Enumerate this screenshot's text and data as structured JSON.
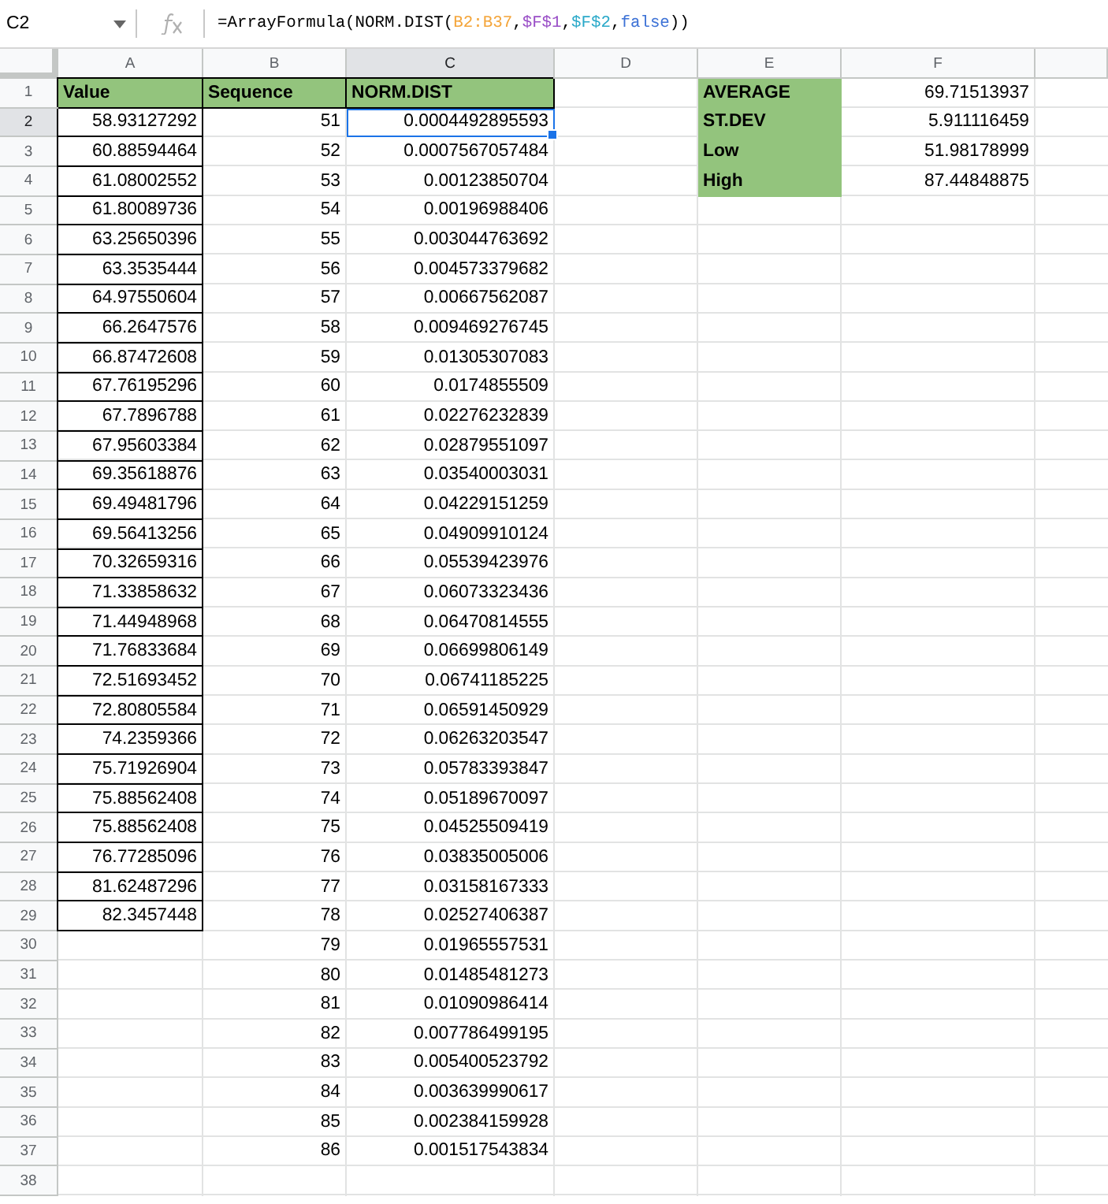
{
  "formula_bar": {
    "cell_ref": "C2",
    "formula": [
      {
        "text": "=ArrayFormula(NORM.DIST(",
        "color": "#000000"
      },
      {
        "text": "B2:B37",
        "color": "#f4a53a"
      },
      {
        "text": ",",
        "color": "#000000"
      },
      {
        "text": "$F$1",
        "color": "#9a4fc7"
      },
      {
        "text": ",",
        "color": "#000000"
      },
      {
        "text": "$F$2",
        "color": "#2ba9c9"
      },
      {
        "text": ",",
        "color": "#000000"
      },
      {
        "text": "false",
        "color": "#3d72d6"
      },
      {
        "text": "))",
        "color": "#000000"
      }
    ]
  },
  "row_numbers": [
    "1",
    "2",
    "3",
    "4",
    "5",
    "6",
    "7",
    "8",
    "9",
    "10",
    "11",
    "12",
    "13",
    "14",
    "15",
    "16",
    "17",
    "18",
    "19",
    "20",
    "21",
    "22",
    "23",
    "24",
    "25",
    "26",
    "27",
    "28",
    "29",
    "30",
    "31",
    "32",
    "33",
    "34",
    "35",
    "36",
    "37",
    "38"
  ],
  "columns": [
    {
      "letter": "A",
      "cells": [
        {
          "text": "Value",
          "kind": "header",
          "selected": false
        },
        {
          "text": "58.93127292",
          "kind": "boxed",
          "selected": false
        },
        {
          "text": "60.88594464",
          "kind": "boxed",
          "selected": false
        },
        {
          "text": "61.08002552",
          "kind": "boxed",
          "selected": false
        },
        {
          "text": "61.80089736",
          "kind": "boxed",
          "selected": false
        },
        {
          "text": "63.25650396",
          "kind": "boxed",
          "selected": false
        },
        {
          "text": "63.3535444",
          "kind": "boxed",
          "selected": false
        },
        {
          "text": "64.97550604",
          "kind": "boxed",
          "selected": false
        },
        {
          "text": "66.2647576",
          "kind": "boxed",
          "selected": false
        },
        {
          "text": "66.87472608",
          "kind": "boxed",
          "selected": false
        },
        {
          "text": "67.76195296",
          "kind": "boxed",
          "selected": false
        },
        {
          "text": "67.7896788",
          "kind": "boxed",
          "selected": false
        },
        {
          "text": "67.95603384",
          "kind": "boxed",
          "selected": false
        },
        {
          "text": "69.35618876",
          "kind": "boxed",
          "selected": false
        },
        {
          "text": "69.49481796",
          "kind": "boxed",
          "selected": false
        },
        {
          "text": "69.56413256",
          "kind": "boxed",
          "selected": false
        },
        {
          "text": "70.32659316",
          "kind": "boxed",
          "selected": false
        },
        {
          "text": "71.33858632",
          "kind": "boxed",
          "selected": false
        },
        {
          "text": "71.44948968",
          "kind": "boxed",
          "selected": false
        },
        {
          "text": "71.76833684",
          "kind": "boxed",
          "selected": false
        },
        {
          "text": "72.51693452",
          "kind": "boxed",
          "selected": false
        },
        {
          "text": "72.80805584",
          "kind": "boxed",
          "selected": false
        },
        {
          "text": "74.2359366",
          "kind": "boxed",
          "selected": false
        },
        {
          "text": "75.71926904",
          "kind": "boxed",
          "selected": false
        },
        {
          "text": "75.88562408",
          "kind": "boxed",
          "selected": false
        },
        {
          "text": "75.88562408",
          "kind": "boxed",
          "selected": false
        },
        {
          "text": "76.77285096",
          "kind": "boxed",
          "selected": false
        },
        {
          "text": "81.62487296",
          "kind": "boxed",
          "selected": false
        },
        {
          "text": "82.3457448",
          "kind": "boxed",
          "selected": false
        }
      ]
    },
    {
      "letter": "B",
      "cells": [
        {
          "text": "Sequence",
          "kind": "header",
          "selected": false
        },
        {
          "text": "51",
          "kind": "number",
          "selected": false
        },
        {
          "text": "52",
          "kind": "number",
          "selected": false
        },
        {
          "text": "53",
          "kind": "number",
          "selected": false
        },
        {
          "text": "54",
          "kind": "number",
          "selected": false
        },
        {
          "text": "55",
          "kind": "number",
          "selected": false
        },
        {
          "text": "56",
          "kind": "number",
          "selected": false
        },
        {
          "text": "57",
          "kind": "number",
          "selected": false
        },
        {
          "text": "58",
          "kind": "number",
          "selected": false
        },
        {
          "text": "59",
          "kind": "number",
          "selected": false
        },
        {
          "text": "60",
          "kind": "number",
          "selected": false
        },
        {
          "text": "61",
          "kind": "number",
          "selected": false
        },
        {
          "text": "62",
          "kind": "number",
          "selected": false
        },
        {
          "text": "63",
          "kind": "number",
          "selected": false
        },
        {
          "text": "64",
          "kind": "number",
          "selected": false
        },
        {
          "text": "65",
          "kind": "number",
          "selected": false
        },
        {
          "text": "66",
          "kind": "number",
          "selected": false
        },
        {
          "text": "67",
          "kind": "number",
          "selected": false
        },
        {
          "text": "68",
          "kind": "number",
          "selected": false
        },
        {
          "text": "69",
          "kind": "number",
          "selected": false
        },
        {
          "text": "70",
          "kind": "number",
          "selected": false
        },
        {
          "text": "71",
          "kind": "number",
          "selected": false
        },
        {
          "text": "72",
          "kind": "number",
          "selected": false
        },
        {
          "text": "73",
          "kind": "number",
          "selected": false
        },
        {
          "text": "74",
          "kind": "number",
          "selected": false
        },
        {
          "text": "75",
          "kind": "number",
          "selected": false
        },
        {
          "text": "76",
          "kind": "number",
          "selected": false
        },
        {
          "text": "77",
          "kind": "number",
          "selected": false
        },
        {
          "text": "78",
          "kind": "number",
          "selected": false
        },
        {
          "text": "79",
          "kind": "number",
          "selected": false
        },
        {
          "text": "80",
          "kind": "number",
          "selected": false
        },
        {
          "text": "81",
          "kind": "number",
          "selected": false
        },
        {
          "text": "82",
          "kind": "number",
          "selected": false
        },
        {
          "text": "83",
          "kind": "number",
          "selected": false
        },
        {
          "text": "84",
          "kind": "number",
          "selected": false
        },
        {
          "text": "85",
          "kind": "number",
          "selected": false
        },
        {
          "text": "86",
          "kind": "number",
          "selected": false
        }
      ]
    },
    {
      "letter": "C",
      "cells": [
        {
          "text": "NORM.DIST",
          "kind": "header",
          "selected": false
        },
        {
          "text": "0.0004492895593",
          "kind": "number",
          "selected": true
        },
        {
          "text": "0.0007567057484",
          "kind": "number",
          "selected": false
        },
        {
          "text": "0.00123850704",
          "kind": "number",
          "selected": false
        },
        {
          "text": "0.00196988406",
          "kind": "number",
          "selected": false
        },
        {
          "text": "0.003044763692",
          "kind": "number",
          "selected": false
        },
        {
          "text": "0.004573379682",
          "kind": "number",
          "selected": false
        },
        {
          "text": "0.00667562087",
          "kind": "number",
          "selected": false
        },
        {
          "text": "0.009469276745",
          "kind": "number",
          "selected": false
        },
        {
          "text": "0.01305307083",
          "kind": "number",
          "selected": false
        },
        {
          "text": "0.0174855509",
          "kind": "number",
          "selected": false
        },
        {
          "text": "0.02276232839",
          "kind": "number",
          "selected": false
        },
        {
          "text": "0.02879551097",
          "kind": "number",
          "selected": false
        },
        {
          "text": "0.03540003031",
          "kind": "number",
          "selected": false
        },
        {
          "text": "0.04229151259",
          "kind": "number",
          "selected": false
        },
        {
          "text": "0.04909910124",
          "kind": "number",
          "selected": false
        },
        {
          "text": "0.05539423976",
          "kind": "number",
          "selected": false
        },
        {
          "text": "0.06073323436",
          "kind": "number",
          "selected": false
        },
        {
          "text": "0.06470814555",
          "kind": "number",
          "selected": false
        },
        {
          "text": "0.06699806149",
          "kind": "number",
          "selected": false
        },
        {
          "text": "0.06741185225",
          "kind": "number",
          "selected": false
        },
        {
          "text": "0.06591450929",
          "kind": "number",
          "selected": false
        },
        {
          "text": "0.06263203547",
          "kind": "number",
          "selected": false
        },
        {
          "text": "0.05783393847",
          "kind": "number",
          "selected": false
        },
        {
          "text": "0.05189670097",
          "kind": "number",
          "selected": false
        },
        {
          "text": "0.04525509419",
          "kind": "number",
          "selected": false
        },
        {
          "text": "0.03835005006",
          "kind": "number",
          "selected": false
        },
        {
          "text": "0.03158167333",
          "kind": "number",
          "selected": false
        },
        {
          "text": "0.02527406387",
          "kind": "number",
          "selected": false
        },
        {
          "text": "0.01965557531",
          "kind": "number",
          "selected": false
        },
        {
          "text": "0.01485481273",
          "kind": "number",
          "selected": false
        },
        {
          "text": "0.01090986414",
          "kind": "number",
          "selected": false
        },
        {
          "text": "0.007786499195",
          "kind": "number",
          "selected": false
        },
        {
          "text": "0.005400523792",
          "kind": "number",
          "selected": false
        },
        {
          "text": "0.003639990617",
          "kind": "number",
          "selected": false
        },
        {
          "text": "0.002384159928",
          "kind": "number",
          "selected": false
        },
        {
          "text": "0.001517543834",
          "kind": "number",
          "selected": false
        }
      ]
    },
    {
      "letter": "D"
    },
    {
      "letter": "E",
      "cells": [
        {
          "text": "AVERAGE",
          "kind": "label",
          "selected": false
        },
        {
          "text": "ST.DEV",
          "kind": "label",
          "selected": false
        },
        {
          "text": "Low",
          "kind": "label",
          "selected": false
        },
        {
          "text": "High",
          "kind": "label",
          "selected": false
        }
      ]
    },
    {
      "letter": "F",
      "cells": [
        {
          "text": "69.71513937",
          "kind": "number",
          "selected": false
        },
        {
          "text": "5.911116459",
          "kind": "number",
          "selected": false
        },
        {
          "text": "51.98178999",
          "kind": "number",
          "selected": false
        },
        {
          "text": "87.44848875",
          "kind": "number",
          "selected": false
        }
      ]
    }
  ]
}
